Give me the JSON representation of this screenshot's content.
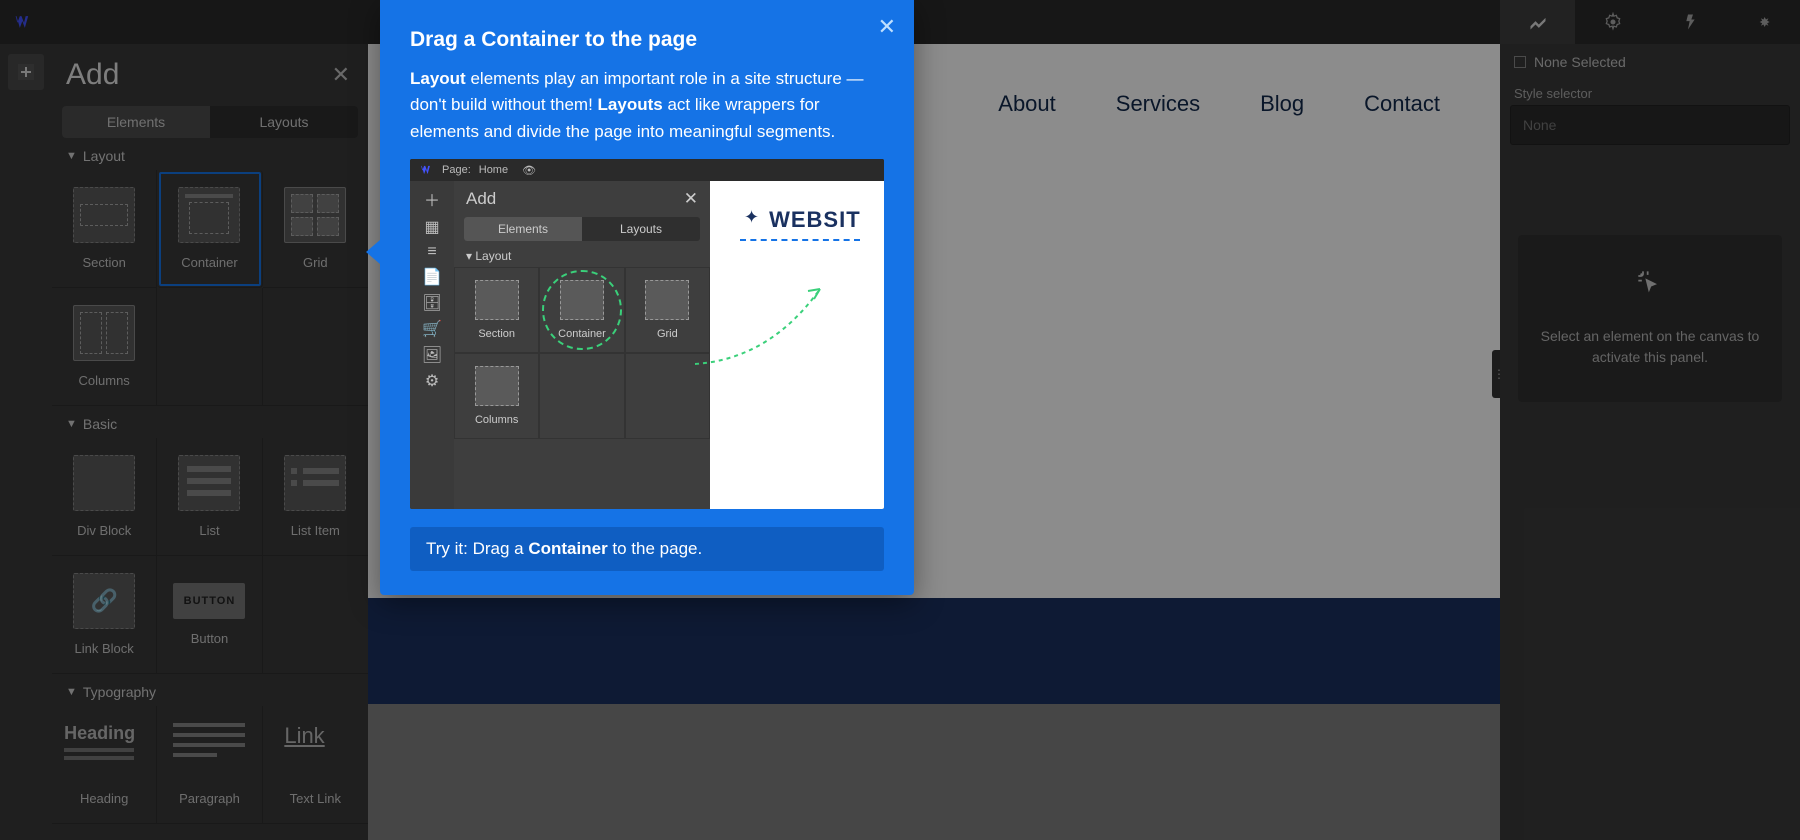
{
  "topbar": {
    "logo_alt": "webflow-logo"
  },
  "addPanel": {
    "title": "Add",
    "tab_elements": "Elements",
    "tab_layouts": "Layouts",
    "sec_layout": "Layout",
    "sec_basic": "Basic",
    "sec_typo": "Typography",
    "items": {
      "section": "Section",
      "container": "Container",
      "grid": "Grid",
      "columns": "Columns",
      "divblock": "Div Block",
      "list": "List",
      "listitem": "List Item",
      "linkblock": "Link Block",
      "button": "Button",
      "button_thumb": "BUTTON",
      "heading": "Heading",
      "heading_thumb": "Heading",
      "paragraph": "Paragraph",
      "textlink": "Text Link",
      "textlink_thumb": "Link"
    }
  },
  "siteNav": {
    "about": "About",
    "services": "Services",
    "blog": "Blog",
    "contact": "Contact"
  },
  "rightPanel": {
    "crumb": "None Selected",
    "style_label": "Style selector",
    "style_placeholder": "None",
    "empty_hint": "Select an element on the canvas to activate this panel."
  },
  "popup": {
    "title": "Drag a Container to the page",
    "para_layout": "Layout",
    "para_1": " elements play an important role in a site structure — don't build without them! ",
    "para_layouts": "Layouts",
    "para_2": " act like wrappers for elements and divide the page into meaningful segments.",
    "try_pre": "Try it: Drag a ",
    "try_bold": "Container",
    "try_post": " to the page.",
    "demo": {
      "page_label": "Page:",
      "page_name": "Home",
      "add": "Add",
      "elements": "Elements",
      "layouts": "Layouts",
      "layout": "Layout",
      "section": "Section",
      "container": "Container",
      "grid": "Grid",
      "columns": "Columns",
      "websit": "WEBSIT"
    }
  }
}
